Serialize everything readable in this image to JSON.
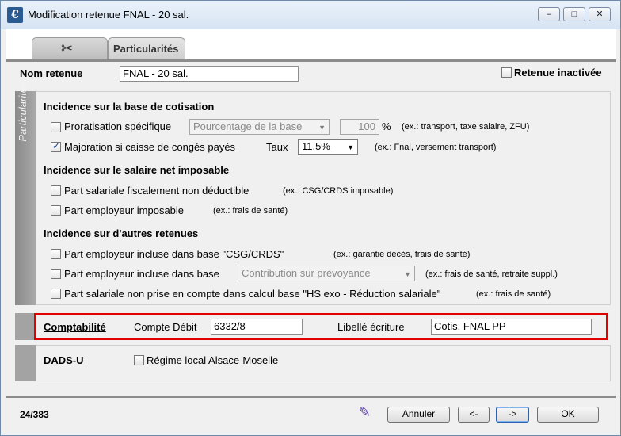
{
  "window": {
    "title": "Modification retenue FNAL - 20 sal.",
    "minimize": "‒",
    "maximize": "□",
    "close": "✕"
  },
  "tabs": {
    "icon_tab_glyph": "✂",
    "active_label": "Particularités"
  },
  "nom_retenue": {
    "label": "Nom retenue",
    "value": "FNAL - 20 sal.",
    "inactive_label": "Retenue inactivée",
    "inactive_checked": false
  },
  "side_label": "Particularités",
  "base_cotisation": {
    "heading": "Incidence sur la base de cotisation",
    "proratisation_label": "Proratisation spécifique",
    "proratisation_checked": false,
    "proratisation_combo": "Pourcentage de la base",
    "percent_value": "100",
    "percent_unit": "%",
    "proratisation_hint": "(ex.: transport, taxe salaire, ZFU)",
    "majoration_label": "Majoration si caisse de congés payés",
    "majoration_checked": true,
    "taux_label": "Taux",
    "taux_value": "11,5%",
    "majoration_hint": "(ex.: Fnal, versement transport)"
  },
  "salaire_net": {
    "heading": "Incidence sur le salaire net imposable",
    "part_salariale_label": "Part salariale fiscalement non déductible",
    "part_salariale_hint": "(ex.: CSG/CRDS imposable)",
    "part_employeur_label": "Part employeur imposable",
    "part_employeur_hint": "(ex.: frais de santé)"
  },
  "autres_retenues": {
    "heading": "Incidence sur d'autres retenues",
    "csg_label": "Part employeur incluse dans base \"CSG/CRDS\"",
    "csg_hint": "(ex.: garantie décès, frais de santé)",
    "base_label": "Part employeur incluse dans base",
    "base_combo": "Contribution sur prévoyance",
    "base_hint": "(ex.: frais de santé, retraite suppl.)",
    "hs_label": "Part salariale non prise en compte dans calcul base \"HS exo - Réduction salariale\"",
    "hs_hint": "(ex.: frais de santé)"
  },
  "comptabilite": {
    "heading": "Comptabilité",
    "compte_label": "Compte Débit",
    "compte_value": "6332/8",
    "libelle_label": "Libellé écriture",
    "libelle_value": "Cotis. FNAL PP"
  },
  "dads": {
    "heading": "DADS-U",
    "regime_label": "Régime local Alsace-Moselle",
    "regime_checked": false
  },
  "footer": {
    "record_counter": "24/383",
    "edit_icon": "✎",
    "cancel": "Annuler",
    "prev": "<-",
    "next": "->",
    "ok": "OK"
  },
  "colors": {
    "highlight_border": "#e00000",
    "title_bar": "#d7e4f2"
  }
}
